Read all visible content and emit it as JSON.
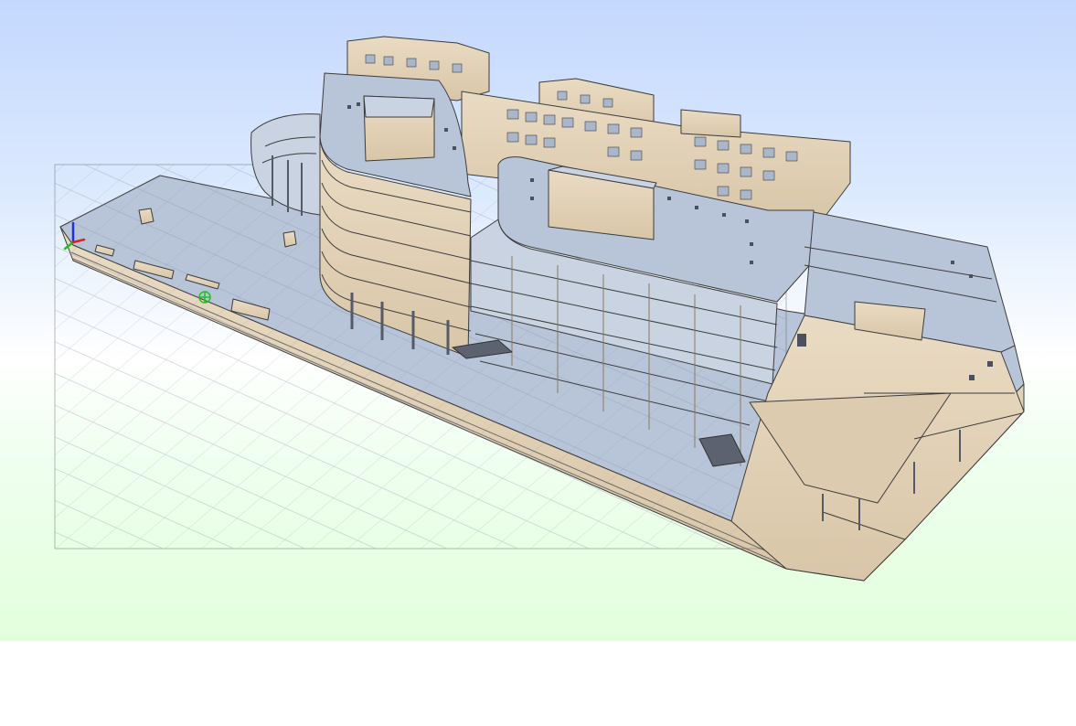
{
  "viewer": {
    "background_top": "#c4d8fe",
    "background_bottom": "#e2ffdc",
    "model_colors": {
      "wall": "#e8d8be",
      "wall_shade": "#d6c3a4",
      "slab": "#b7c4d8",
      "outline": "#3c3c3c",
      "column": "#555b66"
    },
    "axis_colors": {
      "x": "#e02020",
      "y": "#20c020",
      "z": "#2030e0"
    },
    "icons": [
      "axis-triad-icon",
      "orbit-pivot-icon"
    ]
  }
}
